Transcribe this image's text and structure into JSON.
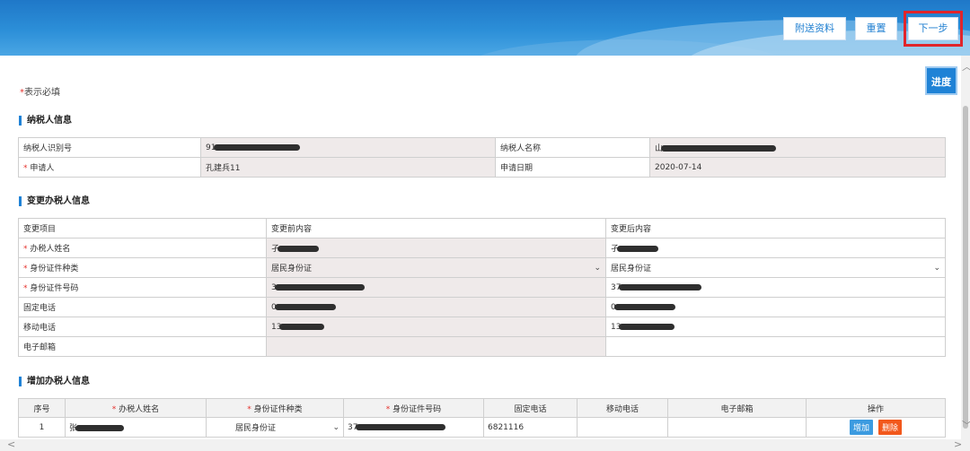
{
  "toolbar": {
    "attach_label": "附送资料",
    "reset_label": "重置",
    "next_label": "下一步"
  },
  "required_note": "表示必填",
  "progress_label": "进度",
  "taxpayer_section": {
    "title": "纳税人信息",
    "id_label": "纳税人识别号",
    "id_value_prefix": "91",
    "name_label": "纳税人名称",
    "name_value_prefix": "山",
    "applicant_label": "申请人",
    "applicant_value": "孔建兵11",
    "apply_date_label": "申请日期",
    "apply_date_value": "2020-07-14"
  },
  "change_section": {
    "title": "变更办税人信息",
    "headers": [
      "变更项目",
      "变更前内容",
      "变更后内容"
    ],
    "rows": [
      {
        "label": "办税人姓名",
        "required": true,
        "before": "孑",
        "after": "孑"
      },
      {
        "label": "身份证件种类",
        "required": true,
        "before": "居民身份证",
        "after": "居民身份证"
      },
      {
        "label": "身份证件号码",
        "required": true,
        "before": "3",
        "after": "37"
      },
      {
        "label": "固定电话",
        "required": false,
        "before": "0",
        "after": "0"
      },
      {
        "label": "移动电话",
        "required": false,
        "before": "13",
        "after": "13"
      },
      {
        "label": "电子邮箱",
        "required": false,
        "before": "",
        "after": ""
      }
    ]
  },
  "add_section": {
    "title": "增加办税人信息",
    "headers": [
      "序号",
      "办税人姓名",
      "身份证件种类",
      "身份证件号码",
      "固定电话",
      "移动电话",
      "电子邮箱",
      "操作"
    ],
    "row": {
      "index": "1",
      "name_prefix": "张",
      "id_type": "居民身份证",
      "id_number_prefix": "37",
      "fixed_phone": "6821116",
      "mobile": "",
      "email": "",
      "add_label": "增加",
      "delete_label": "删除"
    }
  },
  "colors": {
    "accent": "#1f82d6",
    "required": "#e5322d",
    "delete": "#f2581c",
    "add": "#3c9be0",
    "highlight_frame": "#e0252b"
  }
}
